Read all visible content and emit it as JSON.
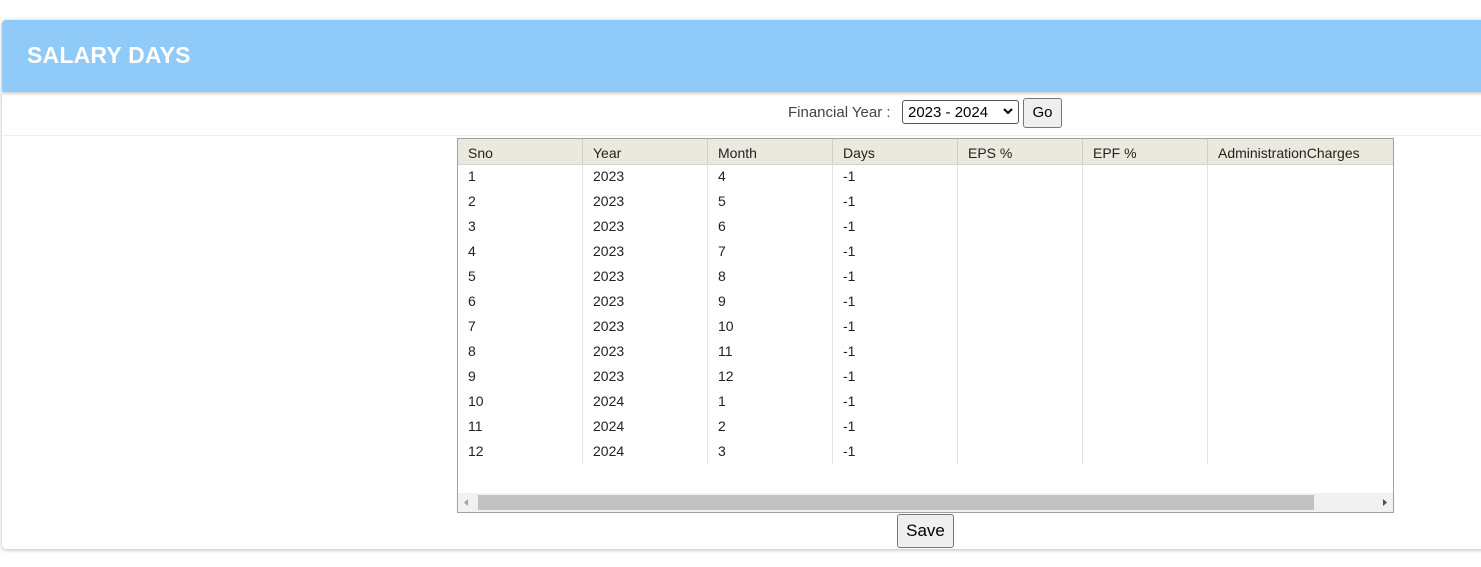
{
  "page": {
    "title": "SALARY DAYS",
    "header_color": "#90caf9"
  },
  "filter": {
    "financial_year_label": "Financial Year :",
    "financial_year_value": "2023 - 2024",
    "go_label": "Go"
  },
  "grid": {
    "columns": [
      "Sno",
      "Year",
      "Month",
      "Days",
      "EPS %",
      "EPF %",
      "AdministrationCharges"
    ],
    "rows": [
      [
        "1",
        "2023",
        "4",
        "-1",
        "",
        "",
        ""
      ],
      [
        "2",
        "2023",
        "5",
        "-1",
        "",
        "",
        ""
      ],
      [
        "3",
        "2023",
        "6",
        "-1",
        "",
        "",
        ""
      ],
      [
        "4",
        "2023",
        "7",
        "-1",
        "",
        "",
        ""
      ],
      [
        "5",
        "2023",
        "8",
        "-1",
        "",
        "",
        ""
      ],
      [
        "6",
        "2023",
        "9",
        "-1",
        "",
        "",
        ""
      ],
      [
        "7",
        "2023",
        "10",
        "-1",
        "",
        "",
        ""
      ],
      [
        "8",
        "2023",
        "11",
        "-1",
        "",
        "",
        ""
      ],
      [
        "9",
        "2023",
        "12",
        "-1",
        "",
        "",
        ""
      ],
      [
        "10",
        "2024",
        "1",
        "-1",
        "",
        "",
        ""
      ],
      [
        "11",
        "2024",
        "2",
        "-1",
        "",
        "",
        ""
      ],
      [
        "12",
        "2024",
        "3",
        "-1",
        "",
        "",
        ""
      ]
    ]
  },
  "actions": {
    "save_label": "Save"
  }
}
